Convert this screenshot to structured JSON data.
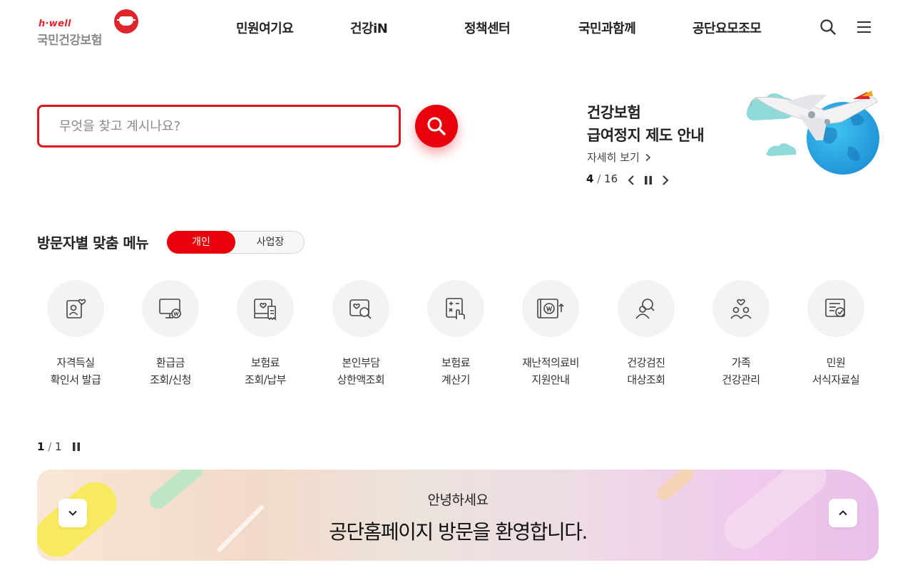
{
  "header": {
    "logo_sub": "h·well",
    "logo_name": "국민건강보험",
    "nav": [
      "민원여기요",
      "건강iN",
      "정책센터",
      "국민과함께",
      "공단요모조모"
    ],
    "icons": [
      "search-icon",
      "hamburger-menu-icon"
    ]
  },
  "search": {
    "placeholder": "무엇을 찾고 계시나요?",
    "value": ""
  },
  "banner": {
    "title_line1": "건강보험",
    "title_line2": "급여정지 제도 안내",
    "link": "자세히 보기",
    "current": "4",
    "total": "16"
  },
  "visitor_menu": {
    "title": "방문자별 맞춤 메뉴",
    "tabs": [
      "개인",
      "사업장"
    ],
    "selected_tab": "개인",
    "items": [
      {
        "line1": "자격득실",
        "line2": "확인서 발급",
        "icon": "certificate-person-icon"
      },
      {
        "line1": "환급금",
        "line2": "조회/신청",
        "icon": "monitor-won-icon"
      },
      {
        "line1": "보험료",
        "line2": "조회/납부",
        "icon": "insurance-bill-icon"
      },
      {
        "line1": "본인부담",
        "line2": "상한액조회",
        "icon": "heart-search-icon"
      },
      {
        "line1": "보험료",
        "line2": "계산기",
        "icon": "calculator-icon"
      },
      {
        "line1": "재난적의료비",
        "line2": "지원안내",
        "icon": "won-support-icon"
      },
      {
        "line1": "건강검진",
        "line2": "대상조회",
        "icon": "checkup-search-icon"
      },
      {
        "line1": "가족",
        "line2": "건강관리",
        "icon": "family-heart-icon"
      },
      {
        "line1": "민원",
        "line2": "서식자료실",
        "icon": "document-form-icon"
      }
    ],
    "current": "1",
    "total": "1"
  },
  "welcome": {
    "greeting": "안녕하세요",
    "message": "공단홈페이지 방문을 환영합니다."
  },
  "colors": {
    "accent": "#e8000b",
    "logo_red": "#e0262c"
  }
}
